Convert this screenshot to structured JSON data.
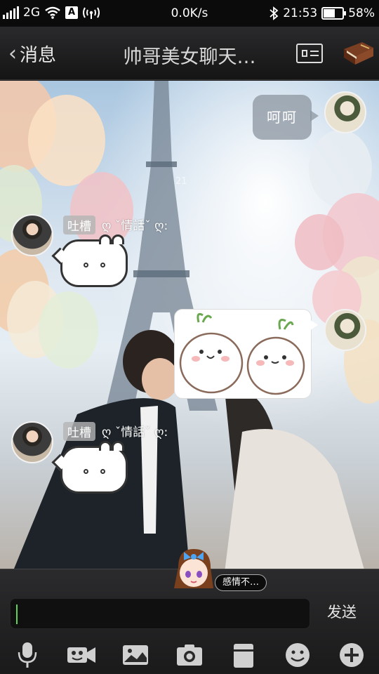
{
  "status_bar": {
    "network": "2G",
    "speed": "0.0K/s",
    "time": "21:53",
    "battery": "58%"
  },
  "header": {
    "back_label": "消息",
    "title": "帅哥美女聊天…"
  },
  "messages": [
    {
      "side": "right",
      "type": "text",
      "text": "呵呵"
    },
    {
      "side": "left",
      "type": "sticker",
      "badge": "吐槽",
      "nickname": "ღ ˇ情話ˇ ღ:",
      "stamp": "21"
    },
    {
      "side": "right",
      "type": "sticker"
    },
    {
      "side": "left",
      "type": "sticker",
      "badge": "吐槽",
      "nickname": "ღ ˇ情話ˇ ღ:"
    }
  ],
  "composer": {
    "mood_tag": "感情不…",
    "send_label": "发送",
    "input_value": ""
  },
  "toolbar": {
    "icons": [
      "microphone-icon",
      "video-icon",
      "image-icon",
      "camera-icon",
      "folder-icon",
      "emoji-icon",
      "plus-icon"
    ]
  },
  "colors": {
    "accent_caret": "#5fd35a",
    "bar_background": "#1c1c1e"
  }
}
